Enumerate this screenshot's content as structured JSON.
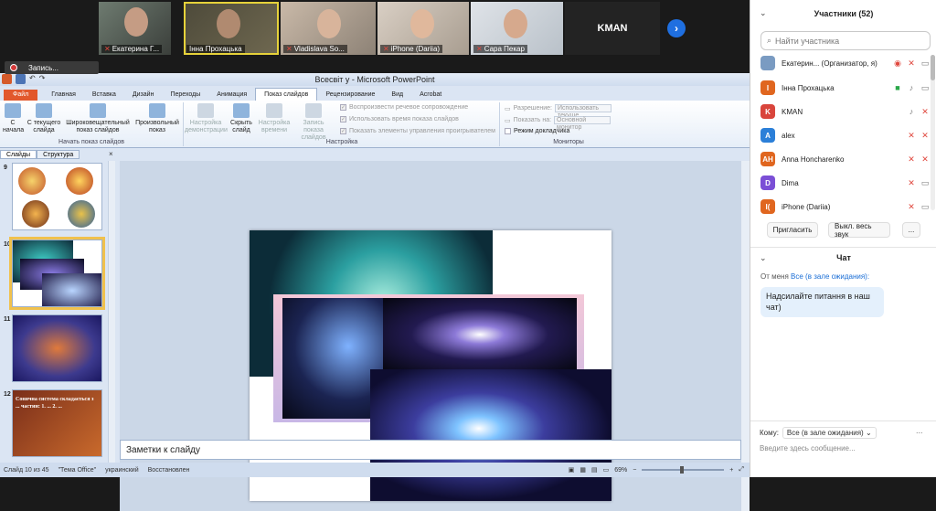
{
  "video": {
    "tiles": [
      {
        "name": "Екатерина Г..."
      },
      {
        "name": "Інна Прохацька"
      },
      {
        "name": "Vladislava So..."
      },
      {
        "name": "iPhone (Dariia)"
      },
      {
        "name": "Сара Пекар"
      }
    ],
    "kman_tile": "KMAN",
    "next_icon": "chevron-right-icon"
  },
  "recording": {
    "label": "Запись..."
  },
  "ppt": {
    "window_title": "Всесвіт у  -  Microsoft PowerPoint",
    "tabs": [
      "Файл",
      "Главная",
      "Вставка",
      "Дизайн",
      "Переходы",
      "Анимация",
      "Показ слайдов",
      "Рецензирование",
      "Вид",
      "Acrobat"
    ],
    "ribbon": {
      "start_show": [
        "С\nначала",
        "С текущего\nслайда",
        "Широковещательный\nпоказ слайдов",
        "Произвольный\nпоказ"
      ],
      "start_group": "Начать показ слайдов",
      "setup_buttons": [
        "Настройка\nдемонстрации",
        "Скрыть\nслайд",
        "Настройка\nвремени",
        "Запись показа\nслайдов"
      ],
      "setup_checks": [
        "Воспроизвести речевое сопровождение",
        "Использовать время показа слайдов",
        "Показать элементы управления проигрывателем"
      ],
      "setup_group": "Настройка",
      "resolution_label": "Разрешение:",
      "resolution_value": "Использовать текуще...",
      "show_on_label": "Показать на:",
      "show_on_value": "Основной монитор",
      "presenter_view": "Режим докладчика",
      "monitors_group": "Мониторы"
    },
    "panel_tabs": [
      "Слайды",
      "Структура"
    ],
    "thumbs": [
      {
        "num": "9"
      },
      {
        "num": "10"
      },
      {
        "num": "11"
      },
      {
        "num": "12",
        "text": "Сонячна система складається з ... частин: 1. ... 2. ..."
      }
    ],
    "notes_placeholder": "Заметки к слайду",
    "status": {
      "slide": "Слайд 10 из 45",
      "theme": "\"Тема Office\"",
      "lang": "украинский",
      "state": "Восстановлен",
      "zoom": "69%"
    }
  },
  "participants": {
    "title": "Участники (52)",
    "search_placeholder": "Найти участника",
    "list": [
      {
        "initial": "",
        "name": "Екатерин... (Организатор, я)",
        "color": "#7a9bc2"
      },
      {
        "initial": "І",
        "name": "Інна Прохацька",
        "color": "#e0661f"
      },
      {
        "initial": "K",
        "name": "KMAN",
        "color": "#d9453c"
      },
      {
        "initial": "A",
        "name": "alex",
        "color": "#2b7fd8"
      },
      {
        "initial": "AH",
        "name": "Anna Honcharenko",
        "color": "#e0661f"
      },
      {
        "initial": "D",
        "name": "Dima",
        "color": "#7b4fd6"
      },
      {
        "initial": "I(",
        "name": "iPhone (Dariia)",
        "color": "#e0661f"
      }
    ],
    "invite": "Пригласить",
    "mute_all": "Выкл. весь звук",
    "more": "..."
  },
  "chat": {
    "title": "Чат",
    "from": "От меня",
    "to": "Все (в зале ожидания):",
    "message": "Надсилайте питання в наш чат)",
    "to_label": "Кому:",
    "to_value": "Все (в зале ожидания)",
    "input_placeholder": "Введите здесь сообщение...",
    "more": "..."
  }
}
